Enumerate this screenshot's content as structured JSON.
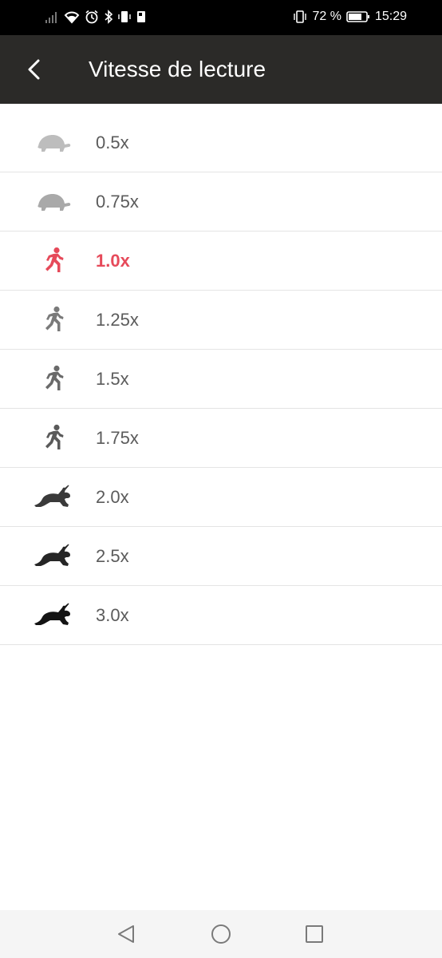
{
  "status_bar": {
    "battery_percent": "72 %",
    "time": "15:29"
  },
  "toolbar": {
    "title": "Vitesse de lecture"
  },
  "speeds": [
    {
      "label": "0.5x",
      "icon": "turtle-icon",
      "color": "#bdbdbd",
      "selected": false
    },
    {
      "label": "0.75x",
      "icon": "turtle-icon",
      "color": "#a9a9a9",
      "selected": false
    },
    {
      "label": "1.0x",
      "icon": "runner-icon",
      "color": "#e64a5a",
      "selected": true
    },
    {
      "label": "1.25x",
      "icon": "runner-icon",
      "color": "#7a7a7a",
      "selected": false
    },
    {
      "label": "1.5x",
      "icon": "runner-icon",
      "color": "#6a6a6a",
      "selected": false
    },
    {
      "label": "1.75x",
      "icon": "runner-icon",
      "color": "#5a5a5a",
      "selected": false
    },
    {
      "label": "2.0x",
      "icon": "rabbit-icon",
      "color": "#3a3a3a",
      "selected": false
    },
    {
      "label": "2.5x",
      "icon": "rabbit-icon",
      "color": "#262626",
      "selected": false
    },
    {
      "label": "3.0x",
      "icon": "rabbit-icon",
      "color": "#141414",
      "selected": false
    }
  ],
  "colors": {
    "toolbar_bg": "#2b2a28",
    "accent": "#e64a5a",
    "label_default": "#5b5b5b"
  }
}
